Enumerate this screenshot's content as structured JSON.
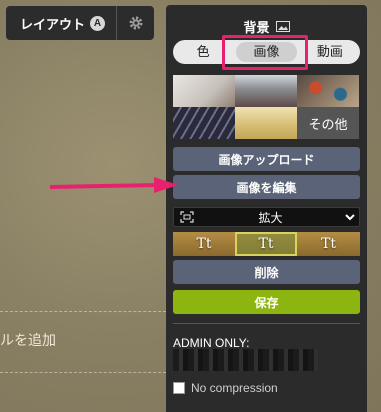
{
  "background_page": {
    "add_text": "ルを追加"
  },
  "toolbar": {
    "layout_label": "レイアウト",
    "layout_badge": "A"
  },
  "panel": {
    "title": "背景",
    "tabs": [
      "色",
      "画像",
      "動画"
    ],
    "active_tab": "画像",
    "thumbnails": [
      {
        "name": "thumb-white-interior"
      },
      {
        "name": "thumb-street-buildings"
      },
      {
        "name": "thumb-paint-cans"
      },
      {
        "name": "thumb-architecture-lines"
      },
      {
        "name": "thumb-wheat-field"
      },
      {
        "label": "その他"
      }
    ],
    "upload_label": "画像アップロード",
    "edit_label": "画像を編集",
    "scale_select": "拡大",
    "font_options": [
      "Tt",
      "Tt",
      "Tt"
    ],
    "selected_font_index": 1,
    "delete_label": "削除",
    "save_label": "保存",
    "admin_label": "ADMIN ONLY:",
    "no_compression_label": "No compression",
    "no_compression_checked": false
  },
  "colors": {
    "highlight": "#e8216e",
    "save_button": "#8db510",
    "action_button": "#5b6378",
    "panel_bg": "#2b2b2b"
  }
}
